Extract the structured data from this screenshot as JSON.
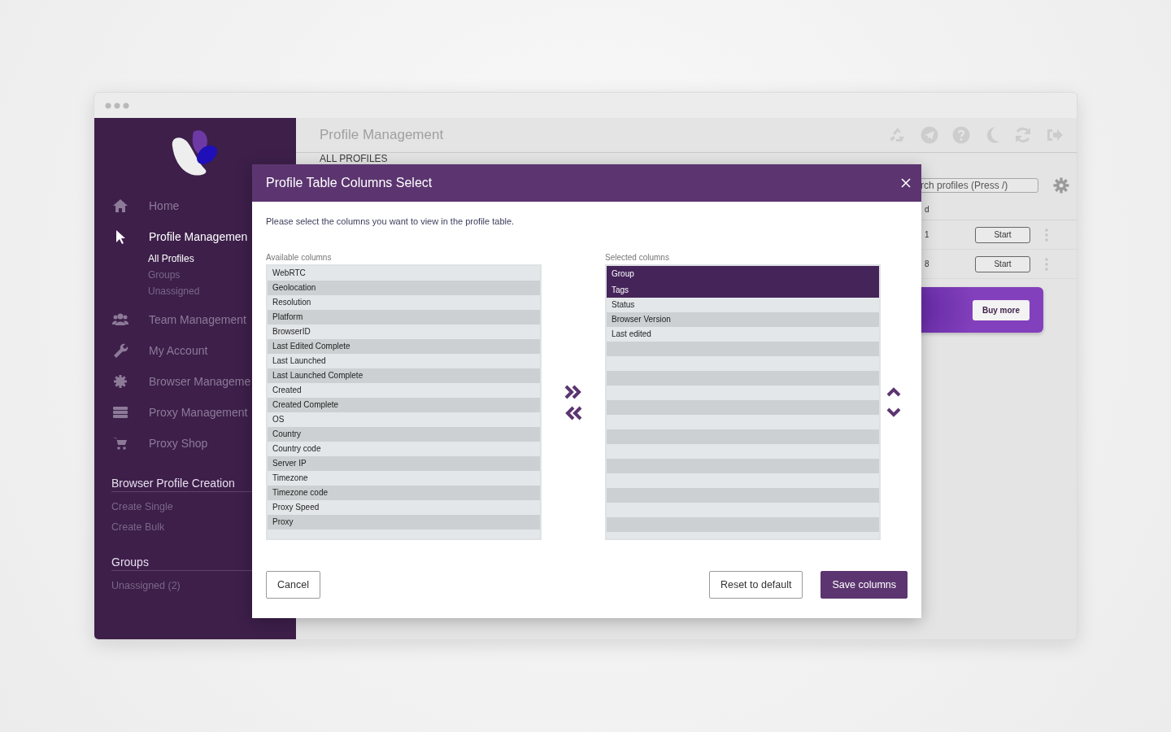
{
  "sidebar": {
    "nav": [
      {
        "label": "Home",
        "active": false
      },
      {
        "label": "Profile Managemen",
        "active": true,
        "children": [
          {
            "label": "All Profiles",
            "selected": true
          },
          {
            "label": "Groups",
            "selected": false
          },
          {
            "label": "Unassigned",
            "selected": false
          }
        ]
      },
      {
        "label": "Team Management",
        "active": false
      },
      {
        "label": "My Account",
        "active": false
      },
      {
        "label": "Browser Manageme",
        "active": false
      },
      {
        "label": "Proxy Management",
        "active": false
      },
      {
        "label": "Proxy Shop",
        "active": false
      }
    ],
    "sections": [
      {
        "title": "Browser Profile Creation",
        "items": [
          "Create Single",
          "Create Bulk"
        ]
      },
      {
        "title": "Groups",
        "items": [
          "Unassigned (2)"
        ]
      }
    ]
  },
  "header": {
    "title": "Profile Management",
    "section": "ALL PROFILES"
  },
  "toolbar": {
    "search_value": "rch profiles (Press /)"
  },
  "table": {
    "header_cell": "d",
    "rows": [
      {
        "cell": "1",
        "action": "Start"
      },
      {
        "cell": "8",
        "action": "Start"
      }
    ]
  },
  "banner": {
    "button": "Buy more"
  },
  "modal": {
    "title": "Profile Table Columns Select",
    "description": "Please select the columns you want to view in the profile table.",
    "available": {
      "label": "Available columns",
      "items": [
        {
          "label": "WebRTC",
          "selected": false
        },
        {
          "label": "Geolocation",
          "selected": false
        },
        {
          "label": "Resolution",
          "selected": false
        },
        {
          "label": "Platform",
          "selected": false
        },
        {
          "label": "BrowserID",
          "selected": false
        },
        {
          "label": "Last Edited Complete",
          "selected": false
        },
        {
          "label": "Last Launched",
          "selected": false
        },
        {
          "label": "Last Launched Complete",
          "selected": false
        },
        {
          "label": "Created",
          "selected": false
        },
        {
          "label": "Created Complete",
          "selected": false
        },
        {
          "label": "OS",
          "selected": false
        },
        {
          "label": "Country",
          "selected": false
        },
        {
          "label": "Country code",
          "selected": false
        },
        {
          "label": "Server IP",
          "selected": false
        },
        {
          "label": "Timezone",
          "selected": false
        },
        {
          "label": "Timezone code",
          "selected": false
        },
        {
          "label": "Proxy Speed",
          "selected": false
        },
        {
          "label": "Proxy",
          "selected": false
        }
      ]
    },
    "chosen": {
      "label": "Selected columns",
      "items": [
        {
          "label": "Group",
          "selected": true
        },
        {
          "label": "Tags",
          "selected": true
        },
        {
          "label": "Status",
          "selected": false
        },
        {
          "label": "Browser Version",
          "selected": false
        },
        {
          "label": "Last edited",
          "selected": false
        }
      ]
    },
    "buttons": [
      {
        "label": "Cancel",
        "kind": "secondary"
      },
      {
        "label": "Reset to default",
        "kind": "secondary"
      },
      {
        "label": "Save columns",
        "kind": "primary"
      }
    ]
  }
}
